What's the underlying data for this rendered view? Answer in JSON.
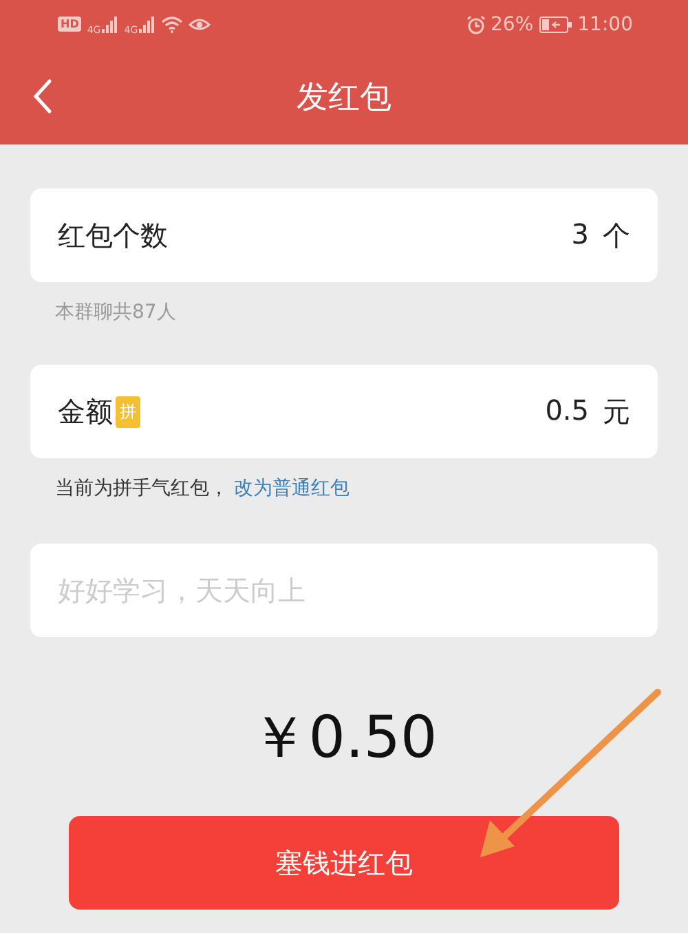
{
  "status_bar": {
    "hd": "HD",
    "network_1": "4G",
    "network_2": "4G",
    "battery": "26%",
    "time": "11:00"
  },
  "nav": {
    "title": "发红包"
  },
  "count_field": {
    "label": "红包个数",
    "value": "3",
    "unit": "个"
  },
  "count_hint": "本群聊共87人",
  "amount_field": {
    "label": "金额",
    "badge": "拼",
    "value": "0.5",
    "unit": "元"
  },
  "amount_hint": {
    "text": "当前为拼手气红包，",
    "link": "改为普通红包"
  },
  "message_field": {
    "placeholder": "好好学习，天天向上"
  },
  "total": "￥0.50",
  "submit_button": "塞钱进红包"
}
